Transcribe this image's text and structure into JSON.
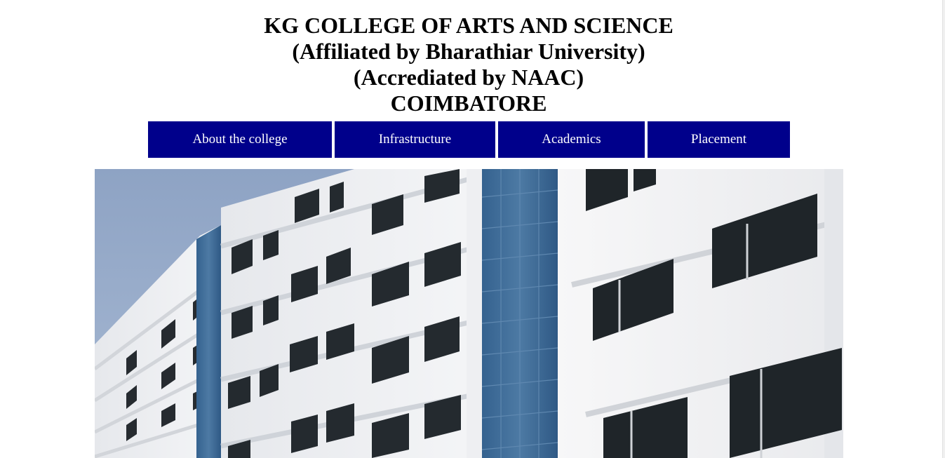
{
  "header": {
    "title": "KG COLLEGE OF ARTS AND SCIENCE",
    "affiliation": "(Affiliated by Bharathiar University)",
    "accreditation": "(Accrediated by NAAC)",
    "city": "COIMBATORE"
  },
  "nav": {
    "items": [
      {
        "label": "About the college"
      },
      {
        "label": "Infrastructure"
      },
      {
        "label": "Academics"
      },
      {
        "label": "Placement"
      }
    ]
  },
  "colors": {
    "nav_background": "#00008b",
    "nav_text": "#ffffff",
    "sky": "#8fa6c8",
    "building": "#f2f3f5",
    "glass": "#3e6a95",
    "window": "#1f2528"
  },
  "hero_image": {
    "subject": "college-building"
  }
}
